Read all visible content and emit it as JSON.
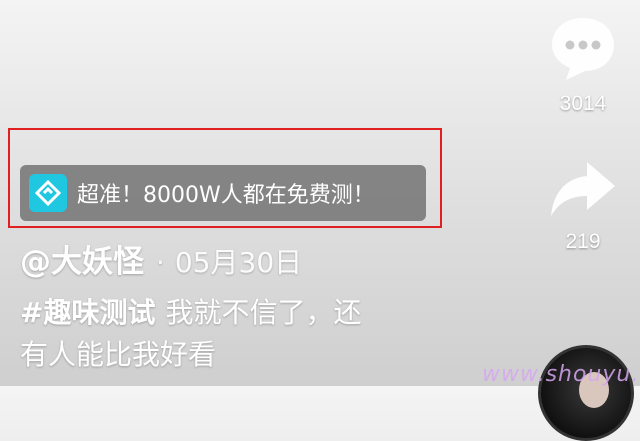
{
  "sidebar": {
    "comment": {
      "icon": "comment-bubble-icon",
      "count": "3014"
    },
    "share": {
      "icon": "share-arrow-icon",
      "count": "219"
    }
  },
  "ad": {
    "icon": "ad-logo-icon",
    "logo_color": "#1fc7e0",
    "text": "超准！8000W人都在免费测！",
    "highlight_color": "#e02020"
  },
  "post": {
    "author": "@大妖怪",
    "separator": "·",
    "date": "05月30日",
    "hashtag": "#趣味测试",
    "caption_line1": "我就不信了，还",
    "caption_line2": "有人能比我好看"
  },
  "watermark": "www.shouyu.ee"
}
